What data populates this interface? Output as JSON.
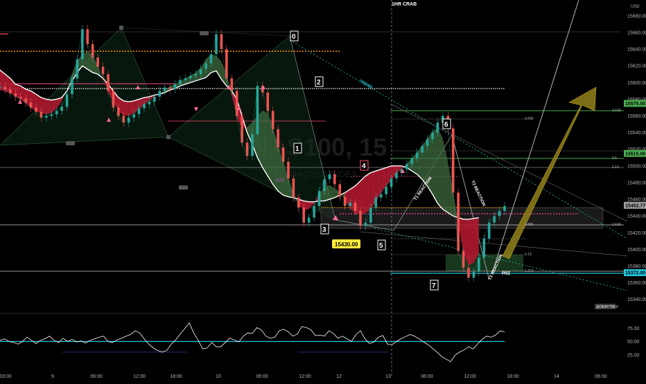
{
  "chart_data": {
    "type": "line",
    "title": "1HR CRAB",
    "currency": "USD",
    "watermark": {
      "ticker": "NAS100, 15",
      "name": "NASDAQ 100 INDEX"
    },
    "x_ticks": [
      "18:00",
      "9",
      "06:00",
      "12:00",
      "18:00",
      "10",
      "06:00",
      "12:00",
      "12",
      "13",
      "06:00",
      "12:00",
      "18:00",
      "14",
      "06:00"
    ],
    "y_ticks": [
      15680,
      15660,
      15640,
      15620,
      15600,
      15580,
      15560,
      15540,
      15520,
      15500,
      15480,
      15460,
      15440,
      15420,
      15400,
      15380,
      15360,
      15340
    ],
    "ylim": [
      15325,
      15694
    ],
    "rsi": {
      "ticks": [
        "75.00",
        "50.00",
        "25.00"
      ],
      "level": 50,
      "range": [
        0,
        100
      ]
    },
    "price_badges": [
      {
        "label": "15575.00",
        "value": 15575,
        "color": "#4caf50"
      },
      {
        "label": "15515.00",
        "value": 15515,
        "color": "#4caf50"
      },
      {
        "label": "15452.77",
        "value": 15452.77,
        "color": "#9e9e9e"
      },
      {
        "label": "15372.00",
        "value": 15372,
        "color": "#26c6da"
      }
    ],
    "entry_label": "15430.00",
    "trend_label": "TREND",
    "pattern_labels": [
      "T1 REACTION",
      "T2 REACTION",
      "T2 REACTION",
      "PRZ"
    ],
    "ok_badge": "@OKAYTREV",
    "waves": [
      "0",
      "1",
      "2",
      "3",
      "4",
      "5",
      "6",
      "7"
    ],
    "fib_labels": [
      "1.13",
      "1.618",
      "1.13",
      "1.272",
      "0.886",
      "0.886",
      "1.618",
      "0.5"
    ],
    "series": [
      {
        "values": [
          15595,
          15592,
          15587,
          15583,
          15581,
          15576,
          15570,
          15565,
          15558,
          15560,
          15562,
          15566,
          15571,
          15586,
          15605,
          15628,
          15664,
          15646,
          15630,
          15619,
          15610,
          15590,
          15570,
          15560,
          15552,
          15558,
          15562,
          15569,
          15574,
          15577,
          15583,
          15590,
          15594,
          15592,
          15598,
          15603,
          15605,
          15608,
          15610,
          15616,
          15623,
          15634,
          15658,
          15640,
          15605,
          15590,
          15560,
          15528,
          15512,
          15538,
          15596,
          15588,
          15566,
          15544,
          15522,
          15505,
          15485,
          15462,
          15450,
          15432,
          15438,
          15452,
          15470,
          15484,
          15490,
          15478,
          15463,
          15452,
          15456,
          15446,
          15428,
          15432,
          15450,
          15462,
          15466,
          15475,
          15485,
          15492,
          15496,
          15502,
          15509,
          15516,
          15524,
          15532,
          15540,
          15552,
          15560,
          15545,
          15468,
          15398,
          15378,
          15366,
          15373,
          15390,
          15413,
          15432,
          15440,
          15446,
          15452
        ]
      },
      {
        "values": [
          15615,
          15610,
          15605,
          15598,
          15596,
          15592,
          15590,
          15586,
          15582,
          15580,
          15579,
          15580,
          15582,
          15590,
          15602,
          15612,
          15620,
          15616,
          15612,
          15610,
          15605,
          15598,
          15590,
          15582,
          15578,
          15577,
          15578,
          15580,
          15582,
          15583,
          15585,
          15586,
          15588,
          15591,
          15593,
          15596,
          15598,
          15600,
          15602,
          15604,
          15606,
          15612,
          15614,
          15604,
          15596,
          15590,
          15580,
          15560,
          15540,
          15526,
          15510,
          15498,
          15488,
          15478,
          15470,
          15465,
          15463,
          15462,
          15460,
          15458,
          15457,
          15457,
          15458,
          15458,
          15460,
          15462,
          15465,
          15468,
          15472,
          15476,
          15482,
          15488,
          15492,
          15494,
          15496,
          15498,
          15500,
          15500,
          15500,
          15498,
          15494,
          15490,
          15484,
          15476,
          15466,
          15455,
          15448,
          15444,
          15440,
          15438,
          15436,
          15436,
          15437,
          15438
        ]
      }
    ],
    "rsi_series": [
      {
        "values": [
          52,
          55,
          50,
          48,
          45,
          50,
          58,
          52,
          46,
          52,
          55,
          60,
          52,
          48,
          56,
          50,
          54,
          49,
          51,
          47,
          52,
          55,
          58,
          60,
          50,
          48,
          53,
          56,
          60,
          63,
          70,
          66,
          55,
          45,
          38,
          33,
          30,
          33,
          45,
          53,
          64,
          74,
          85,
          66,
          52,
          36,
          38,
          48,
          40,
          40,
          48,
          56,
          53,
          49,
          60,
          66,
          65,
          76,
          72,
          60,
          56,
          58,
          70,
          73,
          68,
          60,
          64,
          78,
          76,
          72,
          61,
          62,
          60,
          70,
          65,
          56,
          60,
          55,
          50,
          63,
          70,
          55,
          46,
          49,
          58,
          61,
          45,
          44,
          50,
          55,
          59,
          63,
          60,
          55,
          49,
          44,
          37,
          30,
          22,
          17,
          12,
          24,
          30,
          34,
          40,
          36,
          45,
          54,
          60,
          58,
          62,
          70,
          68
        ]
      }
    ]
  }
}
